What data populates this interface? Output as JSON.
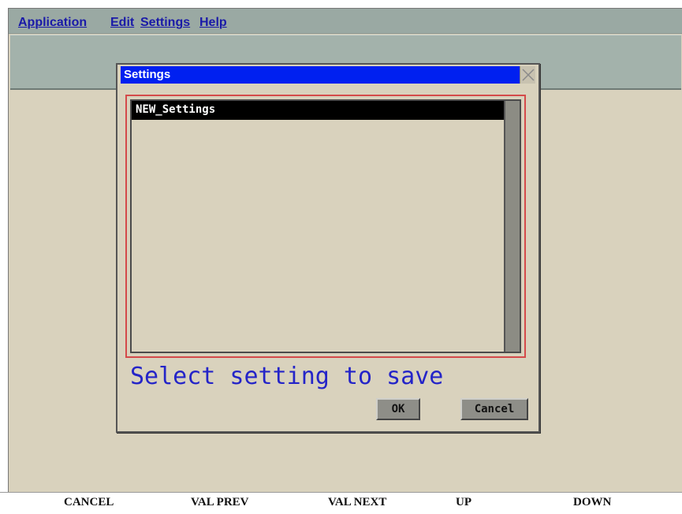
{
  "menu": {
    "items": [
      "Application",
      "Edit",
      "Settings",
      "Help"
    ]
  },
  "dialog": {
    "title": "Settings",
    "list_items": [
      "NEW_Settings"
    ],
    "prompt": "Select setting to save",
    "ok_label": "OK",
    "cancel_label": "Cancel"
  },
  "softkeys": [
    "CANCEL",
    "VAL PREV",
    "VAL NEXT",
    "UP",
    "DOWN"
  ],
  "colors": {
    "title_bar": "#0020f0",
    "prompt_text": "#2424c8",
    "list_outline": "#d44a4a",
    "menu_text": "#1a1aa8"
  },
  "icons": {
    "close": "close-icon"
  }
}
